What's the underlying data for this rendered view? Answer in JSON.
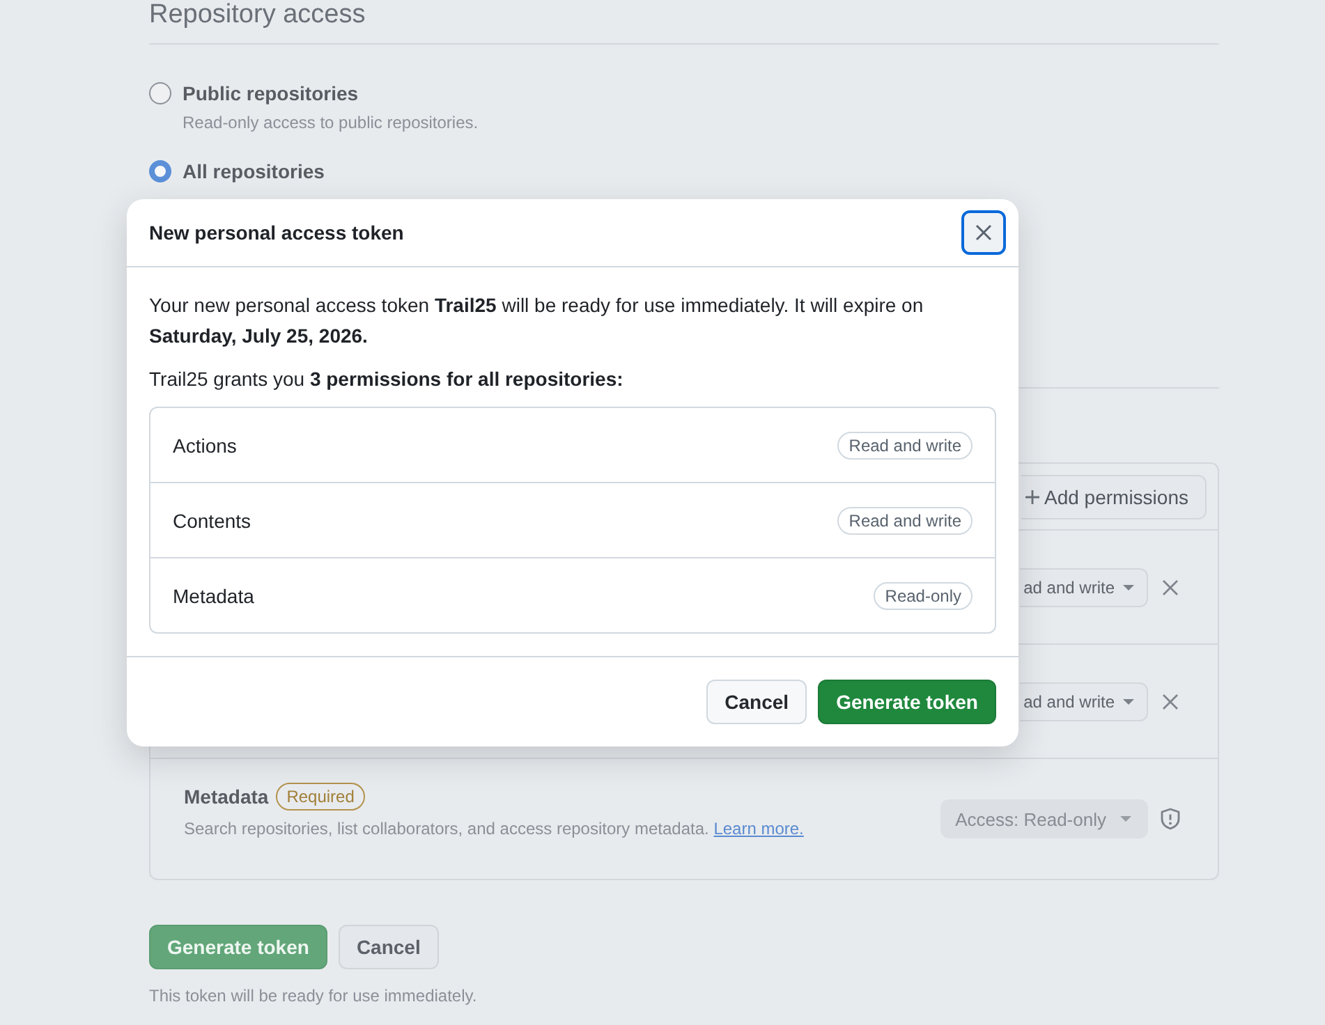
{
  "section": {
    "title": "Repository access"
  },
  "repository_options": [
    {
      "label": "Public repositories",
      "description": "Read-only access to public repositories.",
      "selected": false
    },
    {
      "label": "All repositories",
      "selected": true
    }
  ],
  "permissions_panel": {
    "add_button": "Add permissions",
    "rows": [
      {
        "kind": "editable",
        "access": "ad and write",
        "disabled": false
      },
      {
        "kind": "editable",
        "access": "ad and write",
        "disabled": false
      },
      {
        "kind": "required",
        "name": "Metadata",
        "badge": "Required",
        "description": "Search repositories, list collaborators, and access repository metadata.",
        "link": "Learn more.",
        "access": "Access: Read-only",
        "disabled": true
      }
    ]
  },
  "actions": {
    "buttons": [
      {
        "label": "Generate token",
        "kind": "primary"
      },
      {
        "label": "Cancel",
        "kind": "secondary"
      }
    ],
    "note": "This token will be ready for use immediately."
  },
  "dialog": {
    "title": "New personal access token",
    "close_button": {
      "focused": true
    },
    "message": "Your new personal access token **Trail25** will be ready for use immediately. It will expire on **Saturday, July 25, 2026.**",
    "summary": "Trail25 grants you **3 permissions for all repositories:**",
    "permissions": [
      {
        "name": "Actions",
        "access": "Read and write"
      },
      {
        "name": "Contents",
        "access": "Read and write"
      },
      {
        "name": "Metadata",
        "access": "Read-only"
      }
    ],
    "buttons": [
      {
        "label": "Cancel",
        "kind": "secondary"
      },
      {
        "label": "Generate token",
        "kind": "primary"
      }
    ]
  }
}
